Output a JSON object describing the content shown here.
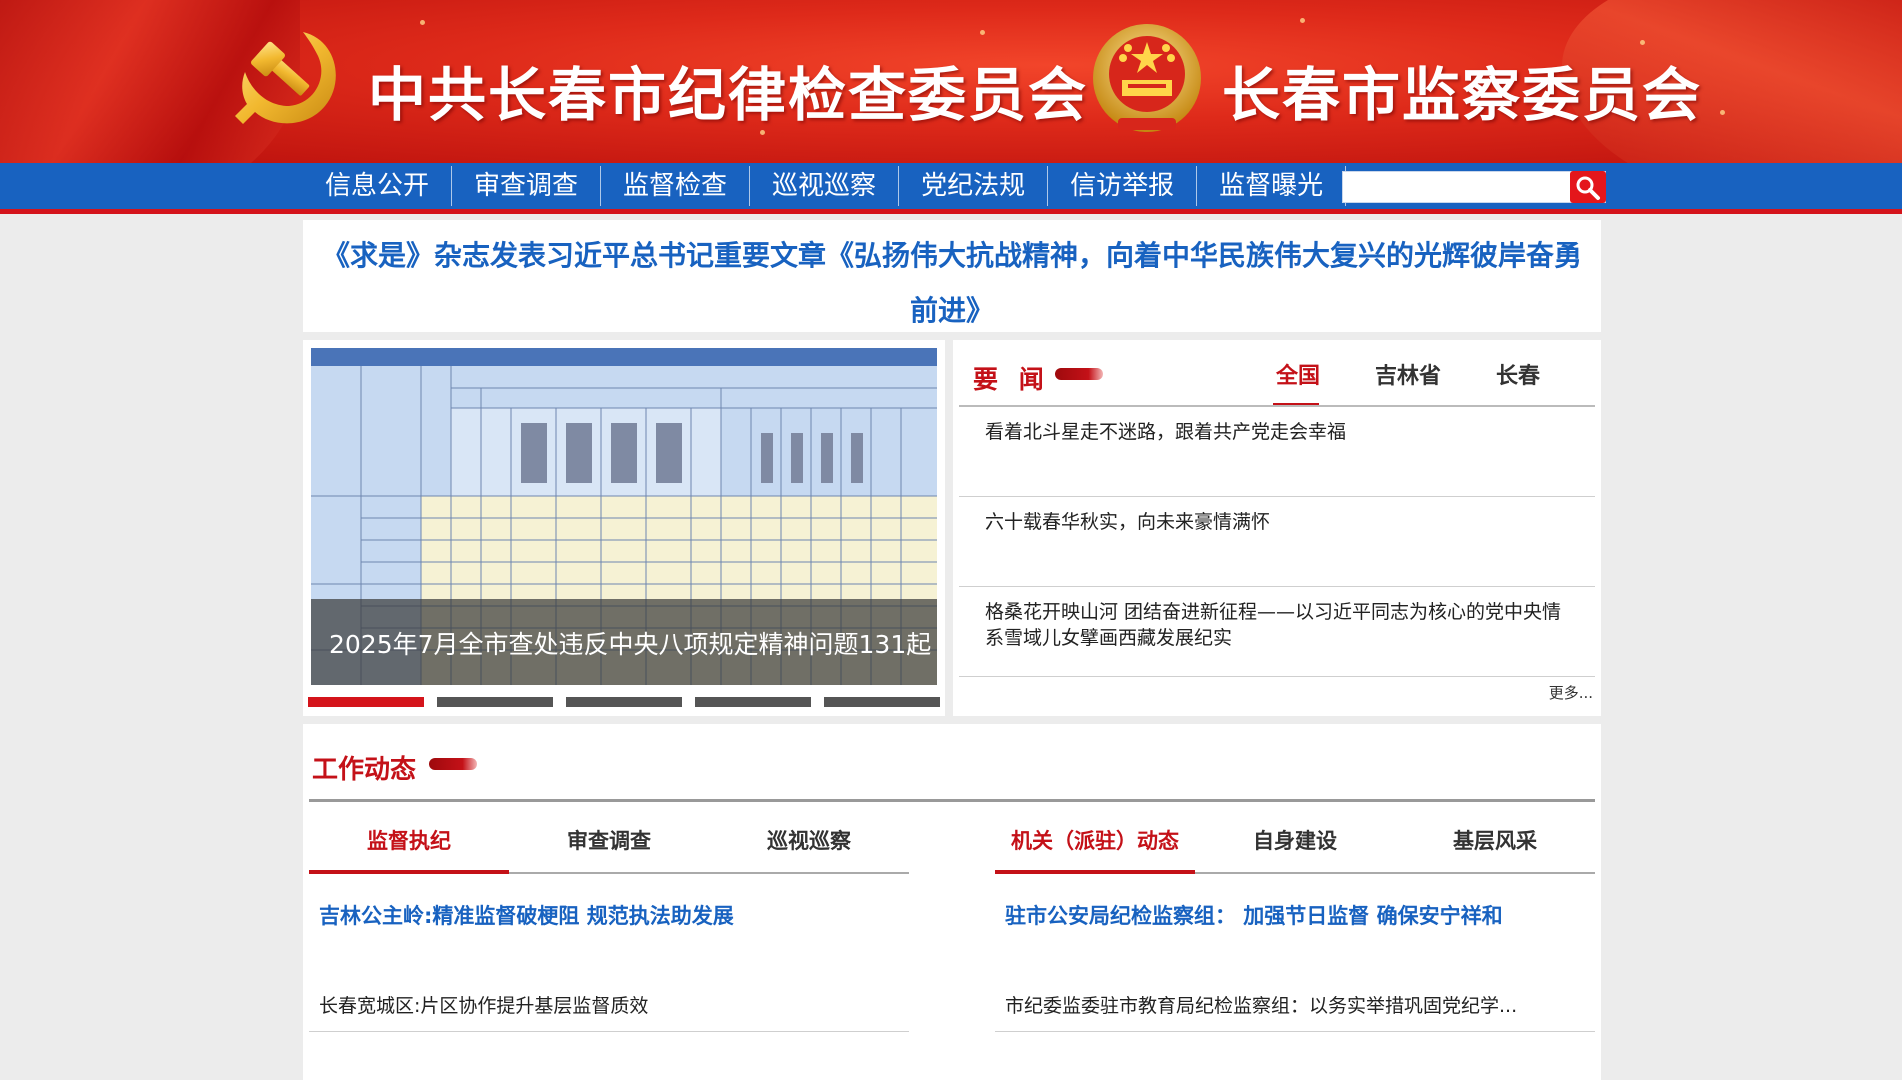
{
  "header": {
    "title_left": "中共长春市纪律检查委员会",
    "title_right": "长春市监察委员会",
    "party_emblem_icon": "hammer-sickle-icon",
    "national_emblem_icon": "national-emblem-icon",
    "colors": {
      "banner_red": "#de2a1a",
      "gold": "#f5c542"
    }
  },
  "nav": {
    "items": [
      "信息公开",
      "审查调查",
      "监督检查",
      "巡视巡察",
      "党纪法规",
      "信访举报",
      "监督曝光"
    ],
    "search_placeholder": "",
    "search_icon": "search-icon",
    "color": "#1862c0"
  },
  "headline": {
    "text": "《求是》杂志发表习近平总书记重要文章《弘扬伟大抗战精神，向着中华民族伟大复兴的光辉彼岸奋勇前进》"
  },
  "carousel": {
    "caption": "2025年7月全市查处违反中央八项规定精神问题131起",
    "slide_count": 5,
    "active_index": 0
  },
  "news": {
    "title": "要 闻",
    "tabs": [
      "全国",
      "吉林省",
      "长春"
    ],
    "active_tab": 0,
    "items": [
      "看着北斗星走不迷路，跟着共产党走会幸福",
      "六十载春华秋实，向未来豪情满怀",
      "格桑花开映山河 团结奋进新征程——以习近平同志为核心的党中央情系雪域儿女擘画西藏发展纪实"
    ],
    "more": "更多..."
  },
  "work": {
    "title": "工作动态",
    "left": {
      "tabs": [
        "监督执纪",
        "审查调查",
        "巡视巡察"
      ],
      "active_tab": 0,
      "feature": "吉林公主岭:精准监督破梗阻 规范执法助发展",
      "items": [
        "长春宽城区:片区协作提升基层监督质效"
      ]
    },
    "right": {
      "tabs": [
        "机关（派驻）动态",
        "自身建设",
        "基层风采"
      ],
      "active_tab": 0,
      "feature": "驻市公安局纪检监察组： 加强节日监督 确保安宁祥和",
      "items": [
        "市纪委监委驻市教育局纪检监察组：以务实举措巩固党纪学..."
      ]
    }
  }
}
